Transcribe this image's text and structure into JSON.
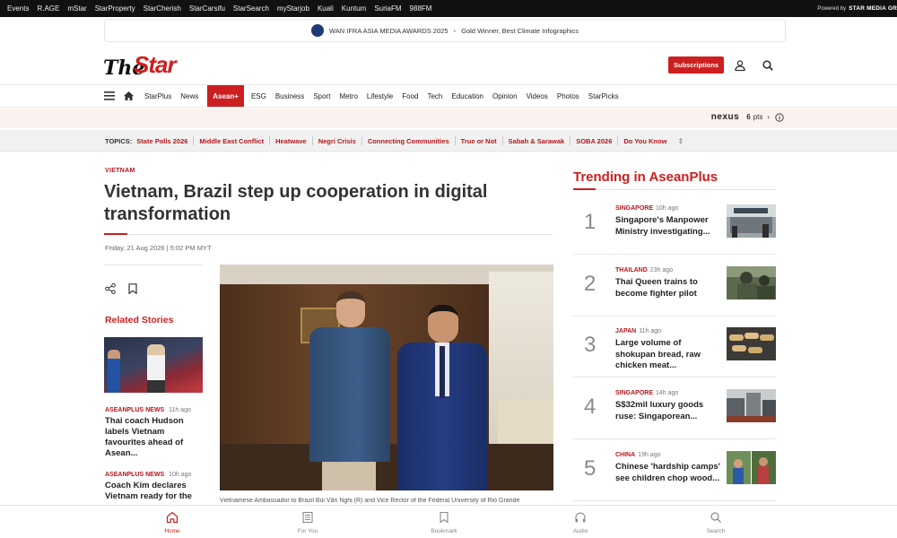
{
  "network_bar": {
    "links": [
      "Events",
      "R.AGE",
      "mStar",
      "StarProperty",
      "StarCherish",
      "StarCarsifu",
      "StarSearch",
      "myStarjob",
      "Kuali",
      "Kuntum",
      "SuriaFM",
      "988FM"
    ],
    "powered_by": "Powered by",
    "powered_brand": "STAR MEDIA GR"
  },
  "award_banner": {
    "title": "WAN IFRA ASIA MEDIA AWARDS 2025",
    "subtitle": "Gold Winner, Best Climate Infographics"
  },
  "header": {
    "logo_the": "The",
    "logo_star": "Star",
    "subscribe_label": "Subscriptions"
  },
  "nav": {
    "items": [
      "StarPlus",
      "News",
      "Asean+",
      "ESG",
      "Business",
      "Sport",
      "Metro",
      "Lifestyle",
      "Food",
      "Tech",
      "Education",
      "Opinion",
      "Videos",
      "Photos",
      "StarPicks"
    ],
    "active": "Asean+"
  },
  "nexus": {
    "brand": "nexus",
    "points": "6",
    "points_unit": "pts"
  },
  "topics": {
    "label": "TOPICS:",
    "items": [
      "State Polls 2026",
      "Middle East Conflict",
      "Heatwave",
      "Negri Crisis",
      "Connecting Communities",
      "True or Not",
      "Sabah & Sarawak",
      "SOBA 2026",
      "Do You Know"
    ]
  },
  "article": {
    "section": "VIETNAM",
    "headline": "Vietnam, Brazil step up cooperation in digital transformation",
    "dateline": "Friday, 21 Aug 2026 | 5:02 PM MYT",
    "caption": "Vietnamese Ambassador to Brazil Bùi Văn Nghị (R) and Vice Rector of the Federal University of Rio Grande"
  },
  "related": {
    "title": "Related Stories",
    "stories": [
      {
        "category": "ASEANPLUS NEWS",
        "time": "11h ago",
        "headline": "Thai coach Hudson labels Vietnam favourites ahead of Asean..."
      },
      {
        "category": "ASEANPLUS NEWS",
        "time": "10h ago",
        "headline": "Coach Kim declares Vietnam ready for the"
      }
    ]
  },
  "trending": {
    "title": "Trending in AseanPlus",
    "items": [
      {
        "num": "1",
        "category": "SINGAPORE",
        "time": "10h ago",
        "headline": "Singapore's Manpower Ministry investigating..."
      },
      {
        "num": "2",
        "category": "THAILAND",
        "time": "23h ago",
        "headline": "Thai Queen trains to become fighter pilot"
      },
      {
        "num": "3",
        "category": "JAPAN",
        "time": "11h ago",
        "headline": "Large volume of shokupan bread, raw chicken meat..."
      },
      {
        "num": "4",
        "category": "SINGAPORE",
        "time": "14h ago",
        "headline": "S$32mil luxury goods ruse: Singaporean..."
      },
      {
        "num": "5",
        "category": "CHINA",
        "time": "19h ago",
        "headline": "Chinese 'hardship camps' see children chop wood..."
      }
    ]
  },
  "bottom_tabs": {
    "items": [
      "Home",
      "For You",
      "Bookmark",
      "Audio",
      "Search"
    ],
    "active": "Home"
  },
  "colors": {
    "brand_red": "#cc1f1f",
    "topic_red": "#b2171d",
    "nexus_bg": "#fbf1ef"
  }
}
